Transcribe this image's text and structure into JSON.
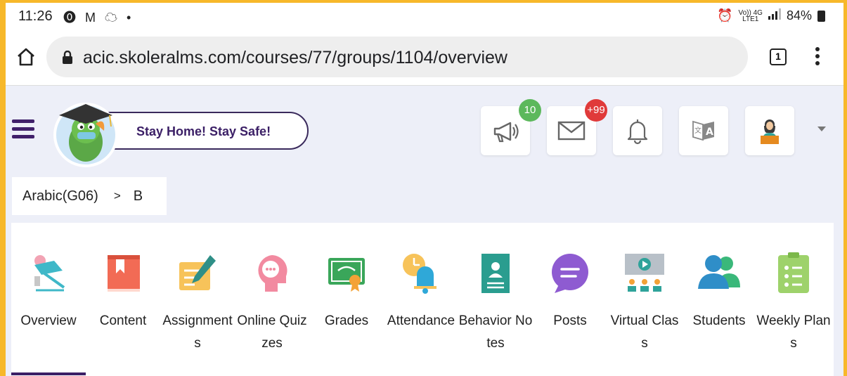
{
  "status_bar": {
    "time": "11:26",
    "notif_icons": "⓿ M ☁ •",
    "network_top": "Vo)) 4G",
    "network_bottom": "LTE1",
    "battery": "84%"
  },
  "browser": {
    "url": "acic.skoleralms.com/courses/77/groups/1104/overview",
    "tab_count": "1"
  },
  "header": {
    "banner": "Stay Home! Stay Safe!",
    "announcements_badge": "10",
    "messages_badge": "+99"
  },
  "breadcrumb": {
    "course": "Arabic(G06)",
    "separator": ">",
    "group": "B"
  },
  "nav": {
    "active": "overview",
    "items": [
      {
        "label": "Overview",
        "icon": "overview-icon"
      },
      {
        "label": "Content",
        "icon": "book-icon"
      },
      {
        "label": "Assignments",
        "icon": "assignment-icon"
      },
      {
        "label": "Online Quizzes",
        "icon": "quiz-icon"
      },
      {
        "label": "Grades",
        "icon": "certificate-icon"
      },
      {
        "label": "Attendance",
        "icon": "bell-clock-icon"
      },
      {
        "label": "Behavior Notes",
        "icon": "id-card-icon"
      },
      {
        "label": "Posts",
        "icon": "chat-bubble-icon"
      },
      {
        "label": "Virtual Class",
        "icon": "video-class-icon"
      },
      {
        "label": "Students",
        "icon": "students-icon"
      },
      {
        "label": "Weekly Plans",
        "icon": "clipboard-icon"
      }
    ]
  },
  "colors": {
    "accent": "#3b1f66",
    "page_bg": "#edeff8",
    "outer_bg": "#f7b82a"
  }
}
